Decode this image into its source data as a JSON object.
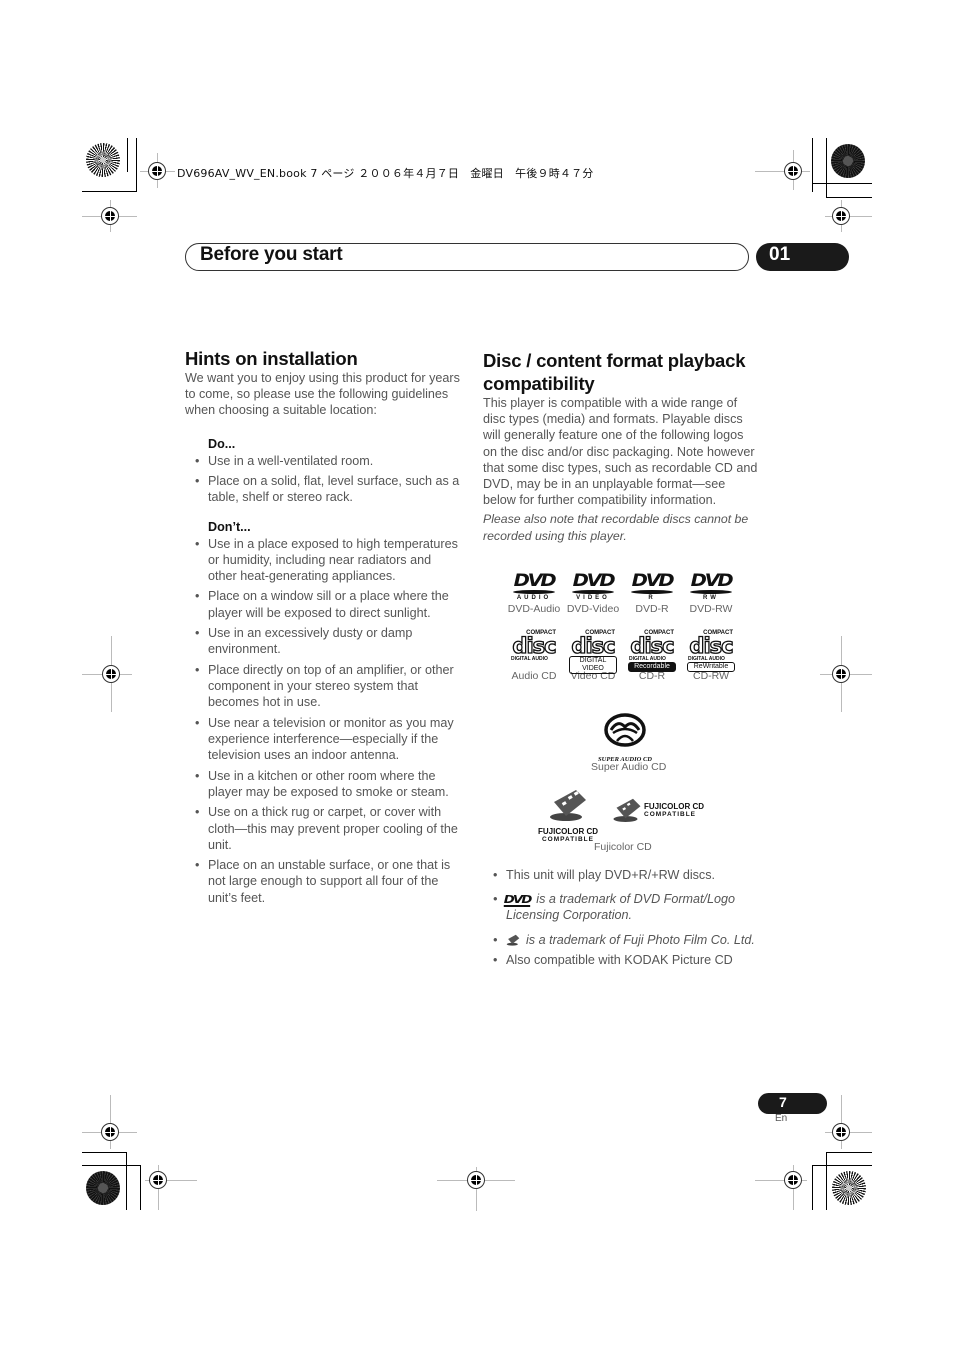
{
  "print_header": {
    "text": "DV696AV_WV_EN.book  7 ページ  ２００６年４月７日　金曜日　午後９時４７分"
  },
  "chapter": {
    "title": "Before you start",
    "number": "01"
  },
  "left_section": {
    "heading": "Hints on installation",
    "intro": "We want you to enjoy using this product for years to come, so please use the following guidelines when choosing a suitable location:",
    "do": {
      "label": "Do...",
      "items": [
        "Use in a well-ventilated room.",
        "Place on a solid, flat, level surface, such as a table, shelf or stereo rack."
      ]
    },
    "dont": {
      "label": "Don’t...",
      "items": [
        "Use in a place exposed to high temperatures or humidity, including near radiators and other heat-generating appliances.",
        "Place on a window sill or a place where the player will be exposed to direct sunlight.",
        "Use in an excessively dusty or damp environment.",
        "Place directly on top of an amplifier, or other component in your stereo system that becomes hot in use.",
        "Use near a television or monitor as you may experience interference—especially if the television uses an indoor antenna.",
        "Use in a kitchen or other room where the player may be exposed to smoke or steam.",
        "Use on a thick rug or carpet, or cover with cloth—this may prevent proper cooling of the unit.",
        "Place on an unstable surface, or one that is not large enough to support all four of the unit’s feet."
      ]
    }
  },
  "right_section": {
    "heading": "Disc / content format playback compatibility",
    "intro": "This player is compatible with a wide range of disc types (media) and formats. Playable discs will generally feature one of the following logos on the disc and/or disc packaging. Note however that some disc types, such as recordable CD and DVD, may be in an unplayable format—see below for further compatibility information.",
    "note": "Please also note that recordable discs cannot be recorded using this player.",
    "dvd_logos": [
      {
        "logo_word": "DVD",
        "logo_sub": "AUDIO",
        "caption": "DVD-Audio"
      },
      {
        "logo_word": "DVD",
        "logo_sub": "VIDEO",
        "caption": "DVD-Video"
      },
      {
        "logo_word": "DVD",
        "logo_sub": "R",
        "caption": "DVD-R"
      },
      {
        "logo_word": "DVD",
        "logo_sub": "RW",
        "caption": "DVD-RW"
      }
    ],
    "cd_logos": [
      {
        "compact": "COMPACT",
        "disc": "disc",
        "sub": "DIGITAL AUDIO",
        "tag": "",
        "caption": "Audio CD"
      },
      {
        "compact": "COMPACT",
        "disc": "disc",
        "sub": "",
        "tag": "DIGITAL VIDEO",
        "caption": "Video CD"
      },
      {
        "compact": "COMPACT",
        "disc": "disc",
        "sub": "DIGITAL AUDIO",
        "tag": "Recordable",
        "caption": "CD-R"
      },
      {
        "compact": "COMPACT",
        "disc": "disc",
        "sub": "DIGITAL AUDIO",
        "tag": "ReWritable",
        "caption": "CD-RW"
      }
    ],
    "sacd": {
      "logo_text": "SUPER AUDIO CD",
      "caption": "Super Audio CD"
    },
    "fuji": {
      "title": "FUJICOLOR CD",
      "sub": "COMPATIBLE",
      "caption": "Fujicolor CD"
    },
    "notes": [
      "This unit will play DVD+R/+RW discs.",
      "is a trademark of DVD Format/Logo Licensing Corporation.",
      "is a trademark of Fuji Photo Film Co. Ltd.",
      "Also compatible with KODAK Picture CD"
    ],
    "notes_dvd_icon": "DVD"
  },
  "footer": {
    "page_number": "7",
    "language": "En"
  }
}
